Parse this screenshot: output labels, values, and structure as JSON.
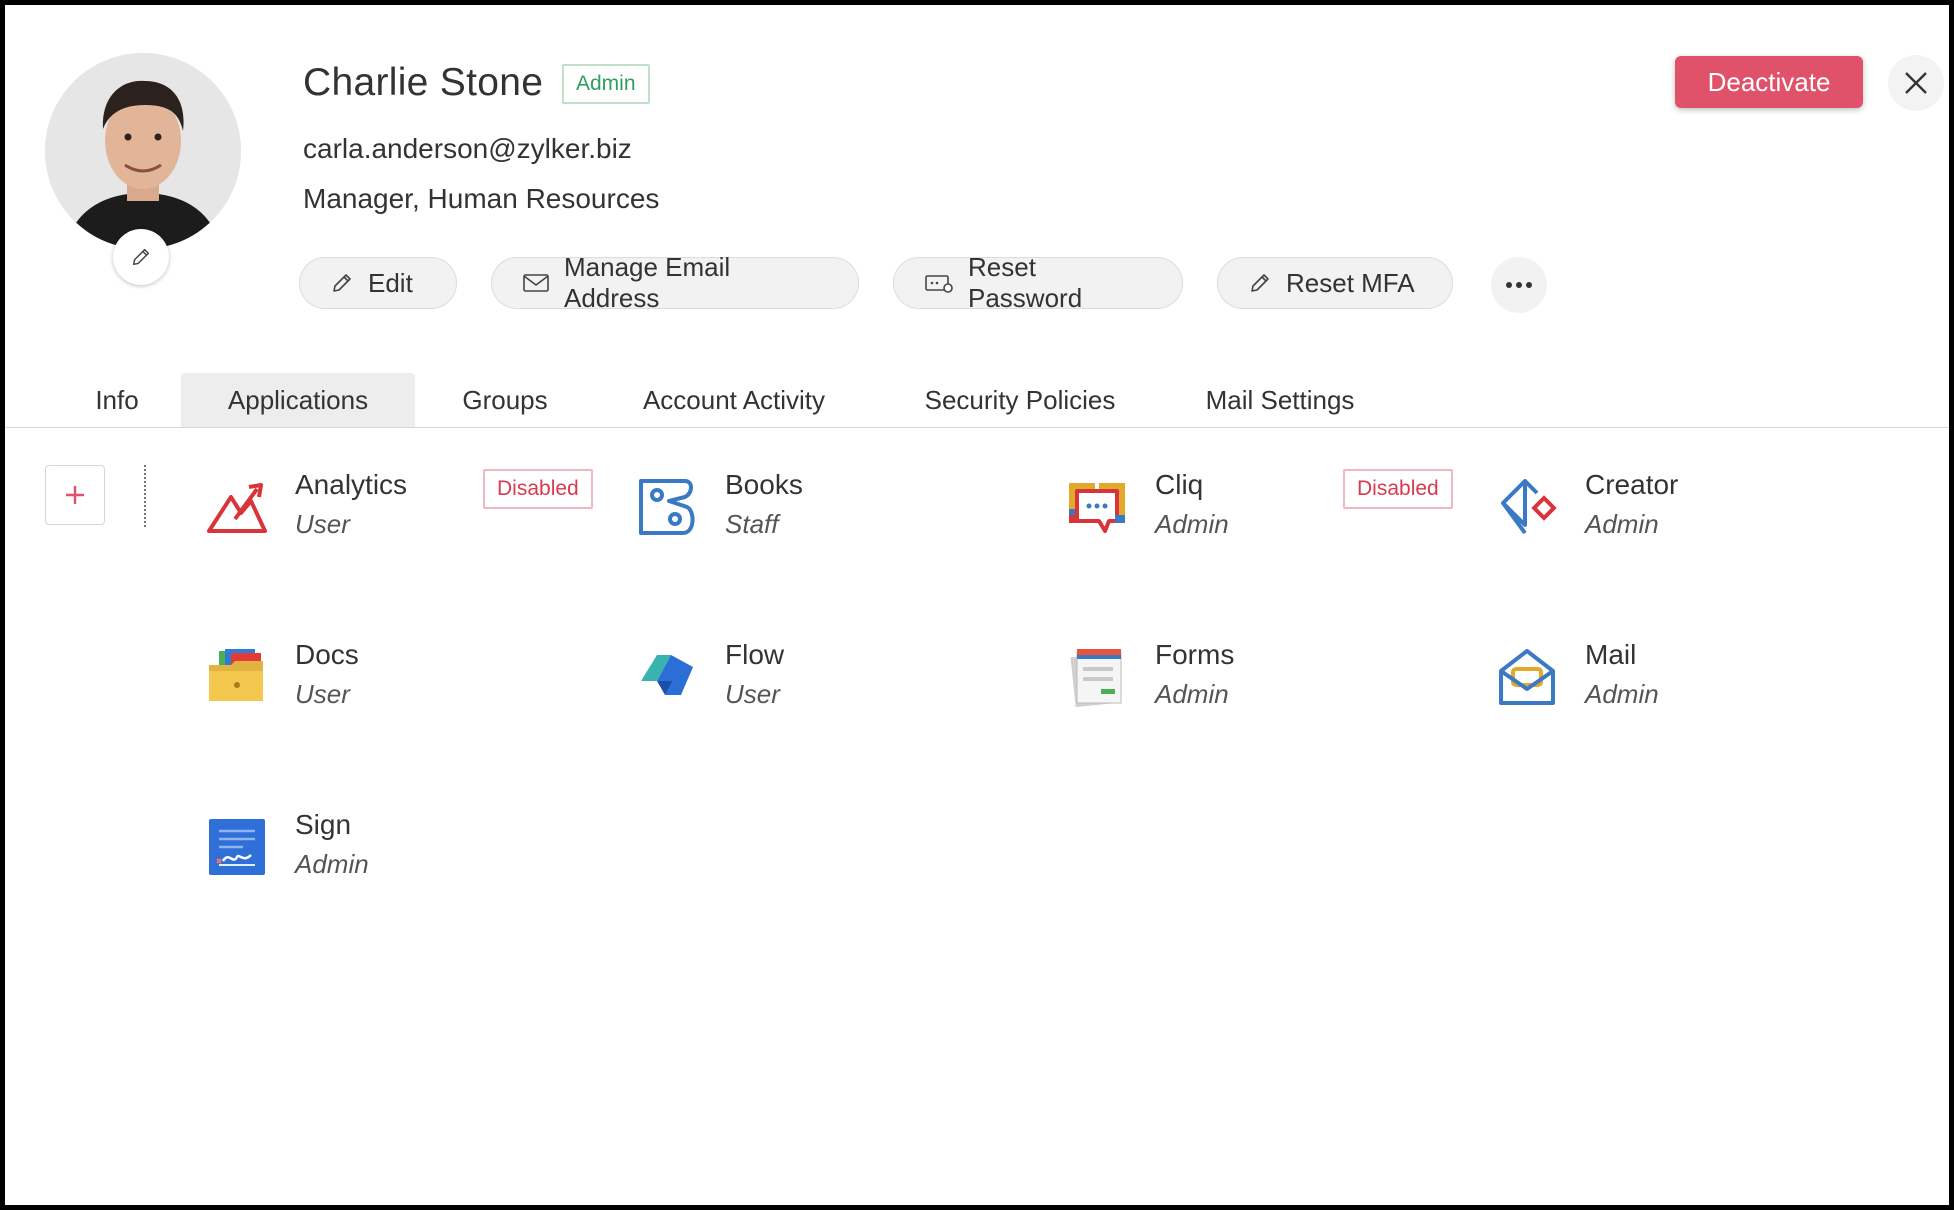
{
  "user": {
    "name": "Charlie Stone",
    "role_badge": "Admin",
    "email": "carla.anderson@zylker.biz",
    "title": "Manager, Human Resources"
  },
  "header": {
    "deactivate_label": "Deactivate"
  },
  "actions": {
    "edit": "Edit",
    "manage_email": "Manage Email Address",
    "reset_password": "Reset Password",
    "reset_mfa": "Reset MFA"
  },
  "tabs": [
    {
      "label": "Info"
    },
    {
      "label": "Applications",
      "active": true
    },
    {
      "label": "Groups"
    },
    {
      "label": "Account Activity"
    },
    {
      "label": "Security Policies"
    },
    {
      "label": "Mail Settings"
    }
  ],
  "apps": [
    {
      "name": "Analytics",
      "role": "User",
      "status": "Disabled",
      "icon": "analytics-icon"
    },
    {
      "name": "Books",
      "role": "Staff",
      "icon": "books-icon"
    },
    {
      "name": "Cliq",
      "role": "Admin",
      "status": "Disabled",
      "icon": "cliq-icon"
    },
    {
      "name": "Creator",
      "role": "Admin",
      "icon": "creator-icon"
    },
    {
      "name": "Docs",
      "role": "User",
      "icon": "docs-icon"
    },
    {
      "name": "Flow",
      "role": "User",
      "icon": "flow-icon"
    },
    {
      "name": "Forms",
      "role": "Admin",
      "icon": "forms-icon"
    },
    {
      "name": "Mail",
      "role": "Admin",
      "icon": "mail-icon"
    },
    {
      "name": "Sign",
      "role": "Admin",
      "icon": "sign-icon"
    }
  ],
  "colors": {
    "accent_danger": "#e0516a",
    "admin_badge": "#2f9e62",
    "disabled_badge": "#d93a50"
  }
}
